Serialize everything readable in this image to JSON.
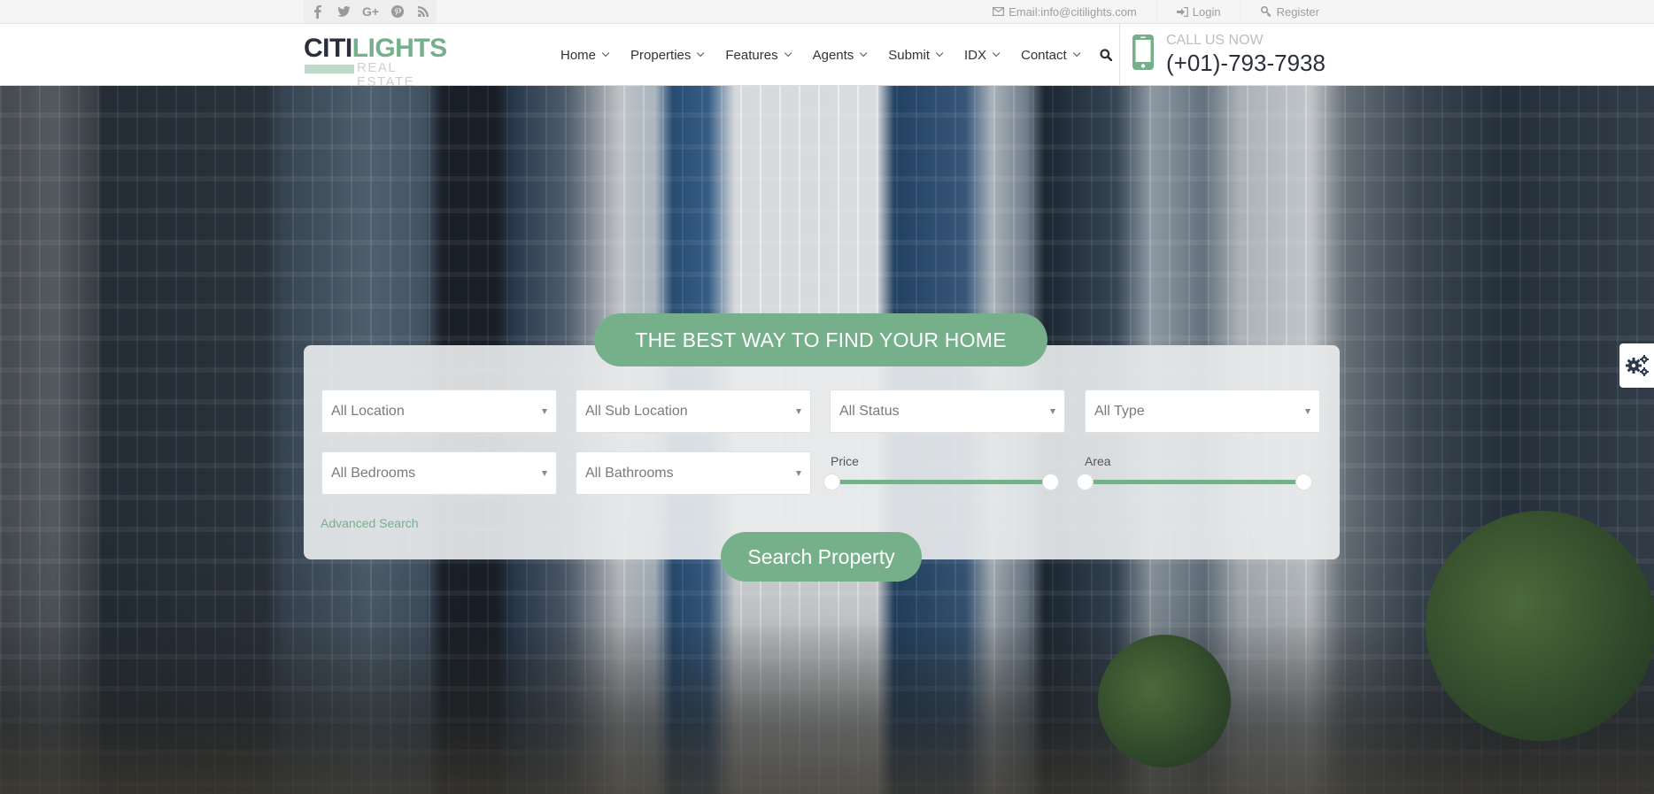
{
  "topbar": {
    "social": [
      {
        "icon": "facebook-icon",
        "glyph": "f"
      },
      {
        "icon": "twitter-icon",
        "glyph": "t"
      },
      {
        "icon": "google-plus-icon",
        "glyph": "G+"
      },
      {
        "icon": "pinterest-icon",
        "glyph": "P"
      },
      {
        "icon": "rss-icon",
        "glyph": "rss"
      }
    ],
    "email_label": "Email:info@citilights.com",
    "login_label": "Login",
    "register_label": "Register"
  },
  "header": {
    "logo_part1": "CITI",
    "logo_part2": "LIGHTS",
    "logo_sub": "REAL ESTATE",
    "nav": [
      {
        "label": "Home"
      },
      {
        "label": "Properties"
      },
      {
        "label": "Features"
      },
      {
        "label": "Agents"
      },
      {
        "label": "Submit"
      },
      {
        "label": "IDX"
      },
      {
        "label": "Contact"
      }
    ],
    "call_label": "CALL US NOW",
    "phone": "(+01)-793-7938"
  },
  "search": {
    "title": "THE BEST WAY TO FIND YOUR HOME",
    "location": "All Location",
    "sub_location": "All Sub Location",
    "status": "All Status",
    "type": "All Type",
    "bedrooms": "All Bedrooms",
    "bathrooms": "All Bathrooms",
    "price_label": "Price",
    "area_label": "Area",
    "price_range_fraction": [
      0,
      1
    ],
    "area_range_fraction": [
      0,
      1
    ],
    "advanced_label": "Advanced Search",
    "submit_label": "Search Property"
  },
  "colors": {
    "accent": "#76b08b",
    "logo_dark": "#2a2e3c",
    "topbar_bg": "#f5f5f5"
  }
}
